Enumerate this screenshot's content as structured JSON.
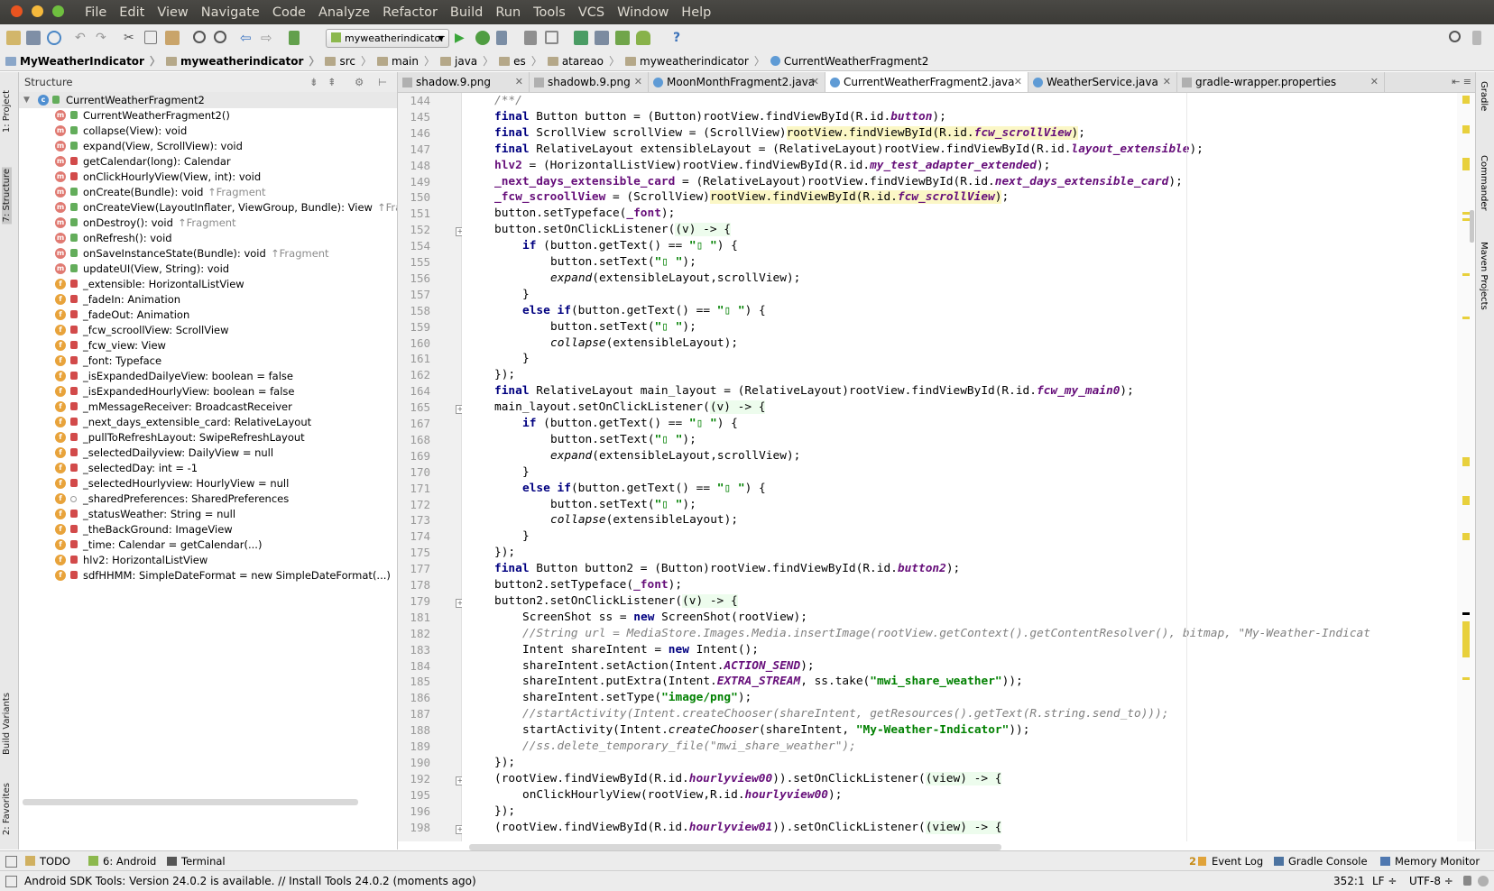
{
  "menu": [
    "File",
    "Edit",
    "View",
    "Navigate",
    "Code",
    "Analyze",
    "Refactor",
    "Build",
    "Run",
    "Tools",
    "VCS",
    "Window",
    "Help"
  ],
  "toolbar": {
    "run_config": "myweatherindicator"
  },
  "breadcrumbs": [
    "MyWeatherIndicator",
    "myweatherindicator",
    "src",
    "main",
    "java",
    "es",
    "atareao",
    "myweatherindicator",
    "CurrentWeatherFragment2"
  ],
  "left_tabs": [
    "1: Project",
    "7: Structure",
    "Build Variants",
    "2: Favorites"
  ],
  "right_tabs": [
    "Gradle",
    "Commander",
    "Maven Projects"
  ],
  "structure": {
    "title": "Structure",
    "root": "CurrentWeatherFragment2",
    "items": [
      {
        "kind": "m",
        "text": "CurrentWeatherFragment2()",
        "inh": ""
      },
      {
        "kind": "m",
        "text": "collapse(View): void",
        "inh": ""
      },
      {
        "kind": "m",
        "text": "expand(View, ScrollView): void",
        "inh": ""
      },
      {
        "kind": "m",
        "text": "getCalendar(long): Calendar",
        "inh": ""
      },
      {
        "kind": "m",
        "text": "onClickHourlyView(View, int): void",
        "inh": ""
      },
      {
        "kind": "m",
        "text": "onCreate(Bundle): void",
        "inh": "↑Fragment"
      },
      {
        "kind": "m",
        "text": "onCreateView(LayoutInflater, ViewGroup, Bundle): View",
        "inh": "↑Fragm"
      },
      {
        "kind": "m",
        "text": "onDestroy(): void",
        "inh": "↑Fragment"
      },
      {
        "kind": "m",
        "text": "onRefresh(): void",
        "inh": ""
      },
      {
        "kind": "m",
        "text": "onSaveInstanceState(Bundle): void",
        "inh": "↑Fragment"
      },
      {
        "kind": "m",
        "text": "updateUI(View, String): void",
        "inh": ""
      },
      {
        "kind": "f",
        "text": "_extensible: HorizontalListView",
        "inh": ""
      },
      {
        "kind": "f",
        "text": "_fadeIn: Animation",
        "inh": ""
      },
      {
        "kind": "f",
        "text": "_fadeOut: Animation",
        "inh": ""
      },
      {
        "kind": "f",
        "text": "_fcw_scroollView: ScrollView",
        "inh": ""
      },
      {
        "kind": "f",
        "text": "_fcw_view: View",
        "inh": ""
      },
      {
        "kind": "f",
        "text": "_font: Typeface",
        "inh": ""
      },
      {
        "kind": "f",
        "text": "_isExpandedDailyeView: boolean = false",
        "inh": ""
      },
      {
        "kind": "f",
        "text": "_isExpandedHourlyView: boolean = false",
        "inh": ""
      },
      {
        "kind": "f",
        "text": "_mMessageReceiver: BroadcastReceiver",
        "inh": ""
      },
      {
        "kind": "f",
        "text": "_next_days_extensible_card: RelativeLayout",
        "inh": ""
      },
      {
        "kind": "f",
        "text": "_pullToRefreshLayout: SwipeRefreshLayout",
        "inh": ""
      },
      {
        "kind": "f",
        "text": "_selectedDailyview: DailyView = null",
        "inh": ""
      },
      {
        "kind": "f",
        "text": "_selectedDay: int = -1",
        "inh": ""
      },
      {
        "kind": "f",
        "text": "_selectedHourlyview: HourlyView = null",
        "inh": ""
      },
      {
        "kind": "f",
        "text": "_sharedPreferences: SharedPreferences",
        "inh": ""
      },
      {
        "kind": "f",
        "text": "_statusWeather: String = null",
        "inh": ""
      },
      {
        "kind": "f",
        "text": "_theBackGround: ImageView",
        "inh": ""
      },
      {
        "kind": "f",
        "text": "_time: Calendar = getCalendar(...)",
        "inh": ""
      },
      {
        "kind": "f",
        "text": "hlv2: HorizontalListView",
        "inh": ""
      },
      {
        "kind": "f",
        "text": "sdfHHMM: SimpleDateFormat = new SimpleDateFormat(...)",
        "inh": ""
      }
    ]
  },
  "tabs": [
    {
      "label": "shadow.9.png",
      "active": false
    },
    {
      "label": "shadowb.9.png",
      "active": false
    },
    {
      "label": "MoonMonthFragment2.java",
      "active": false
    },
    {
      "label": "CurrentWeatherFragment2.java",
      "active": true
    },
    {
      "label": "WeatherService.java",
      "active": false
    },
    {
      "label": "gradle-wrapper.properties",
      "active": false
    }
  ],
  "editor": {
    "lines": [
      {
        "n": "144",
        "fold": false,
        "indent": 0,
        "html": "<span class=\"cm\">/**/</span>"
      },
      {
        "n": "145",
        "fold": false,
        "indent": 0,
        "html": "<span class=\"k\">final</span> Button button = (Button)rootView.findViewById(R.id.<span class=\"fld\">button</span>);"
      },
      {
        "n": "146",
        "fold": false,
        "indent": 0,
        "html": "<span class=\"k\">final</span> ScrollView scrollView = (ScrollView)<span class=\"hl\">rootView.findViewById(R.id.<span class=\"fld\">fcw_scrollView</span>)</span>;"
      },
      {
        "n": "147",
        "fold": false,
        "indent": 0,
        "html": "<span class=\"k\">final</span> RelativeLayout extensibleLayout = (RelativeLayout)rootView.findViewById(R.id.<span class=\"fld\">layout_extensible</span>);"
      },
      {
        "n": "148",
        "fold": false,
        "indent": 0,
        "html": "<span class=\"fl2\">hlv2</span> = (HorizontalListView)rootView.findViewById(R.id.<span class=\"fld\">my_test_adapter_extended</span>);"
      },
      {
        "n": "149",
        "fold": false,
        "indent": 0,
        "html": "<span class=\"fl2\">_next_days_extensible_card</span> = (RelativeLayout)rootView.findViewById(R.id.<span class=\"fld\">next_days_extensible_card</span>);"
      },
      {
        "n": "150",
        "fold": false,
        "indent": 0,
        "html": "<span class=\"fl2\">_fcw_scroollView</span> = (ScrollView)<span class=\"hl\">rootView.findViewById(R.id.<span class=\"fld\">fcw_scrollView</span>)</span>;"
      },
      {
        "n": "151",
        "fold": false,
        "indent": 0,
        "html": "button.setTypeface(<span class=\"fl2\">_font</span>);"
      },
      {
        "n": "152",
        "fold": true,
        "indent": 0,
        "html": "button.setOnClickListener(<span class=\"lam\">(v) -&gt; {</span>"
      },
      {
        "n": "154",
        "fold": false,
        "indent": 1,
        "html": "<span class=\"k\">if</span> (button.getText() == <span class=\"s\">\"▯ \"</span>) {"
      },
      {
        "n": "155",
        "fold": false,
        "indent": 2,
        "html": "button.setText(<span class=\"s\">\"▯ \"</span>);"
      },
      {
        "n": "156",
        "fold": false,
        "indent": 2,
        "html": "<span class=\"it\">expand</span>(extensibleLayout,scrollView);"
      },
      {
        "n": "157",
        "fold": false,
        "indent": 1,
        "html": "}"
      },
      {
        "n": "158",
        "fold": false,
        "indent": 1,
        "html": "<span class=\"k\">else if</span>(button.getText() == <span class=\"s\">\"▯ \"</span>) {"
      },
      {
        "n": "159",
        "fold": false,
        "indent": 2,
        "html": "button.setText(<span class=\"s\">\"▯ \"</span>);"
      },
      {
        "n": "160",
        "fold": false,
        "indent": 2,
        "html": "<span class=\"it\">collapse</span>(extensibleLayout);"
      },
      {
        "n": "161",
        "fold": false,
        "indent": 1,
        "html": "}"
      },
      {
        "n": "162",
        "fold": false,
        "indent": 0,
        "html": "});"
      },
      {
        "n": "164",
        "fold": false,
        "indent": 0,
        "html": "<span class=\"k\">final</span> RelativeLayout main_layout = (RelativeLayout)rootView.findViewById(R.id.<span class=\"fld\">fcw_my_main0</span>);"
      },
      {
        "n": "165",
        "fold": true,
        "indent": 0,
        "html": "main_layout.setOnClickListener(<span class=\"lam\">(v) -&gt; {</span>"
      },
      {
        "n": "167",
        "fold": false,
        "indent": 1,
        "html": "<span class=\"k\">if</span> (button.getText() == <span class=\"s\">\"▯ \"</span>) {"
      },
      {
        "n": "168",
        "fold": false,
        "indent": 2,
        "html": "button.setText(<span class=\"s\">\"▯ \"</span>);"
      },
      {
        "n": "169",
        "fold": false,
        "indent": 2,
        "html": "<span class=\"it\">expand</span>(extensibleLayout,scrollView);"
      },
      {
        "n": "170",
        "fold": false,
        "indent": 1,
        "html": "}"
      },
      {
        "n": "171",
        "fold": false,
        "indent": 1,
        "html": "<span class=\"k\">else if</span>(button.getText() == <span class=\"s\">\"▯ \"</span>) {"
      },
      {
        "n": "172",
        "fold": false,
        "indent": 2,
        "html": "button.setText(<span class=\"s\">\"▯ \"</span>);"
      },
      {
        "n": "173",
        "fold": false,
        "indent": 2,
        "html": "<span class=\"it\">collapse</span>(extensibleLayout);"
      },
      {
        "n": "174",
        "fold": false,
        "indent": 1,
        "html": "}"
      },
      {
        "n": "175",
        "fold": false,
        "indent": 0,
        "html": "});"
      },
      {
        "n": "177",
        "fold": false,
        "indent": 0,
        "html": "<span class=\"k\">final</span> Button button2 = (Button)rootView.findViewById(R.id.<span class=\"fld\">button2</span>);"
      },
      {
        "n": "178",
        "fold": false,
        "indent": 0,
        "html": "button2.setTypeface(<span class=\"fl2\">_font</span>);"
      },
      {
        "n": "179",
        "fold": true,
        "indent": 0,
        "html": "button2.setOnClickListener(<span class=\"lam\">(v) -&gt; {</span>"
      },
      {
        "n": "181",
        "fold": false,
        "indent": 1,
        "html": "ScreenShot ss = <span class=\"k\">new</span> ScreenShot(rootView);"
      },
      {
        "n": "182",
        "fold": false,
        "indent": 1,
        "html": "<span class=\"cm\">//String url = MediaStore.Images.Media.insertImage(rootView.getContext().getContentResolver(), bitmap, \"My-Weather-Indicat</span>"
      },
      {
        "n": "183",
        "fold": false,
        "indent": 1,
        "html": "Intent shareIntent = <span class=\"k\">new</span> Intent();"
      },
      {
        "n": "184",
        "fold": false,
        "indent": 1,
        "html": "shareIntent.setAction(Intent.<span class=\"fld\">ACTION_SEND</span>);"
      },
      {
        "n": "185",
        "fold": false,
        "indent": 1,
        "html": "shareIntent.putExtra(Intent.<span class=\"fld\">EXTRA_STREAM</span>, ss.take(<span class=\"s\">\"mwi_share_weather\"</span>));"
      },
      {
        "n": "186",
        "fold": false,
        "indent": 1,
        "html": "shareIntent.setType(<span class=\"s\">\"image/png\"</span>);"
      },
      {
        "n": "187",
        "fold": false,
        "indent": 1,
        "html": "<span class=\"cm\">//startActivity(Intent.createChooser(shareIntent, getResources().getText(R.string.send_to)));</span>"
      },
      {
        "n": "188",
        "fold": false,
        "indent": 1,
        "html": "startActivity(Intent.<span class=\"it\">createChooser</span>(shareIntent, <span class=\"s\">\"My-Weather-Indicator\"</span>));"
      },
      {
        "n": "189",
        "fold": false,
        "indent": 1,
        "html": "<span class=\"cm\">//ss.delete_temporary_file(\"mwi_share_weather\");</span>"
      },
      {
        "n": "190",
        "fold": false,
        "indent": 0,
        "html": "});"
      },
      {
        "n": "192",
        "fold": true,
        "indent": 0,
        "html": "(rootView.findViewById(R.id.<span class=\"fld\">hourlyview00</span>)).setOnClickListener(<span class=\"lam\">(view) -&gt; {</span>"
      },
      {
        "n": "195",
        "fold": false,
        "indent": 1,
        "html": "onClickHourlyView(rootView,R.id.<span class=\"fld\">hourlyview00</span>);"
      },
      {
        "n": "196",
        "fold": false,
        "indent": 0,
        "html": "});"
      },
      {
        "n": "198",
        "fold": true,
        "indent": 0,
        "html": "(rootView.findViewById(R.id.<span class=\"fld\">hourlyview01</span>)).setOnClickListener(<span class=\"lam\">(view) -&gt; {</span>"
      }
    ]
  },
  "toolwindows": {
    "todo": "TODO",
    "android": "6: Android",
    "terminal": "Terminal",
    "event_log": "Event Log",
    "event_count": "2",
    "gradle_console": "Gradle Console",
    "memory_monitor": "Memory Monitor"
  },
  "status": {
    "message": "Android SDK Tools: Version 24.0.2 is available. // Install Tools 24.0.2 (moments ago)",
    "position": "352:1",
    "line_sep": "LF ÷",
    "encoding": "UTF-8 ÷"
  },
  "colors": {
    "keyword": "#000080",
    "string": "#008000",
    "field": "#660e7a",
    "comment": "#808080",
    "warning_mark": "#e8d03c"
  }
}
